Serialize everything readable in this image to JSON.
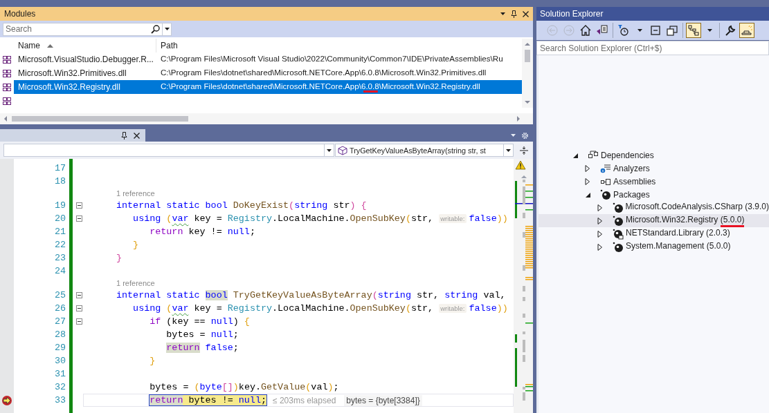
{
  "modules": {
    "title": "Modules",
    "search": {
      "placeholder": "Search"
    },
    "columns": [
      {
        "label": "Name",
        "sorted": true
      },
      {
        "label": "Path",
        "sorted": false
      }
    ],
    "rows": [
      {
        "name": "Microsoft.VisualStudio.Debugger.R...",
        "path": [
          {
            "text": "C:\\Program Files\\Microsoft Visual Studio\\2022\\Community\\Common7\\IDE\\PrivateAssemblies\\Ru",
            "annotated": false
          }
        ],
        "selected": false
      },
      {
        "name": "Microsoft.Win32.Primitives.dll",
        "path": [
          {
            "text": "C:\\Program Files\\dotnet\\shared\\Microsoft.NETCore.App\\6.0.8\\Microsoft.Win32.Primitives.dll",
            "annotated": false
          }
        ],
        "selected": false
      },
      {
        "name": "Microsoft.Win32.Registry.dll",
        "path": [
          {
            "text": "C:\\Program Files\\dotnet\\shared\\Microsoft.NETCore.App\\",
            "annotated": false
          },
          {
            "text": "6.0.8",
            "annotated": true
          },
          {
            "text": "\\Microsoft.Win32.Registry.dll",
            "annotated": false
          }
        ],
        "selected": true
      },
      {
        "selected": false
      }
    ]
  },
  "editor": {
    "navigation": {
      "member": "TryGetKeyValueAsByteArray(string str, st"
    },
    "lines": [
      {
        "kind": "code",
        "number": "17",
        "collapsible": false,
        "current": false
      },
      {
        "kind": "code",
        "number": "18",
        "collapsible": false,
        "current": false
      },
      {
        "kind": "codelens",
        "text": "1 reference"
      },
      {
        "kind": "code",
        "number": "19",
        "collapsible": true,
        "current": false,
        "tokens": [
          {
            "text": "internal static bool ",
            "kind": "kw"
          },
          {
            "text": "DoKeyExist",
            "kind": "method"
          },
          {
            "text": "(",
            "kind": "b1"
          },
          {
            "text": "string",
            "kind": "kw"
          },
          {
            "text": " str",
            "kind": "plain"
          },
          {
            "text": ")",
            "kind": "b1"
          },
          {
            "text": " {",
            "kind": "b1"
          }
        ]
      },
      {
        "kind": "code",
        "number": "20",
        "collapsible": true,
        "current": false,
        "tokens": [
          {
            "text": "   using ",
            "kind": "kw"
          },
          {
            "text": "(",
            "kind": "b2"
          },
          {
            "text": "var",
            "kind": "kw_squiggle"
          },
          {
            "text": " key = ",
            "kind": "plain"
          },
          {
            "text": "Registry",
            "kind": "type"
          },
          {
            "text": ".LocalMachine.",
            "kind": "plain"
          },
          {
            "text": "OpenSubKey",
            "kind": "method"
          },
          {
            "text": "(",
            "kind": "b2"
          },
          {
            "text": "str, ",
            "kind": "plain"
          },
          {
            "text": "writable:",
            "kind": "hint"
          },
          {
            "text": "false",
            "kind": "kw"
          },
          {
            "text": "))",
            "kind": "b2"
          }
        ]
      },
      {
        "kind": "code",
        "number": "21",
        "collapsible": false,
        "current": false,
        "tokens": [
          {
            "text": "      return",
            "kind": "ctl"
          },
          {
            "text": " key != ",
            "kind": "plain"
          },
          {
            "text": "null",
            "kind": "kw"
          },
          {
            "text": ";",
            "kind": "plain"
          }
        ]
      },
      {
        "kind": "code",
        "number": "22",
        "collapsible": false,
        "current": false,
        "tokens": [
          {
            "text": "   }",
            "kind": "b2"
          }
        ]
      },
      {
        "kind": "code",
        "number": "23",
        "collapsible": false,
        "current": false,
        "tokens": [
          {
            "text": "}",
            "kind": "b1"
          }
        ]
      },
      {
        "kind": "code",
        "number": "24",
        "collapsible": false,
        "current": false
      },
      {
        "kind": "codelens",
        "text": "1 reference"
      },
      {
        "kind": "code",
        "number": "25",
        "collapsible": true,
        "current": false,
        "tokens": [
          {
            "text": "internal static ",
            "kind": "kw"
          },
          {
            "text": "bool",
            "kind": "kw_ref"
          },
          {
            "text": " TryGetKeyValueAsByteArray",
            "kind": "method"
          },
          {
            "text": "(",
            "kind": "b1"
          },
          {
            "text": "string",
            "kind": "kw"
          },
          {
            "text": " str, ",
            "kind": "plain"
          },
          {
            "text": "string",
            "kind": "kw"
          },
          {
            "text": " val,",
            "kind": "plain"
          }
        ]
      },
      {
        "kind": "code",
        "number": "26",
        "collapsible": true,
        "current": false,
        "tokens": [
          {
            "text": "   using ",
            "kind": "kw"
          },
          {
            "text": "(",
            "kind": "b2"
          },
          {
            "text": "var",
            "kind": "kw_squiggle"
          },
          {
            "text": " key = ",
            "kind": "plain"
          },
          {
            "text": "Registry",
            "kind": "type"
          },
          {
            "text": ".LocalMachine.",
            "kind": "plain"
          },
          {
            "text": "OpenSubKey",
            "kind": "method"
          },
          {
            "text": "(",
            "kind": "b2"
          },
          {
            "text": "str, ",
            "kind": "plain"
          },
          {
            "text": "writable:",
            "kind": "hint"
          },
          {
            "text": "false",
            "kind": "kw"
          },
          {
            "text": "))",
            "kind": "b2"
          }
        ]
      },
      {
        "kind": "code",
        "number": "27",
        "collapsible": true,
        "current": false,
        "tokens": [
          {
            "text": "      if",
            "kind": "ctl"
          },
          {
            "text": " (key == ",
            "kind": "plain"
          },
          {
            "text": "null",
            "kind": "kw"
          },
          {
            "text": ") ",
            "kind": "plain"
          },
          {
            "text": "{",
            "kind": "b2"
          }
        ]
      },
      {
        "kind": "code",
        "number": "28",
        "collapsible": false,
        "current": false,
        "tokens": [
          {
            "text": "         bytes = ",
            "kind": "plain"
          },
          {
            "text": "null",
            "kind": "kw"
          },
          {
            "text": ";",
            "kind": "plain"
          }
        ]
      },
      {
        "kind": "code",
        "number": "29",
        "collapsible": false,
        "current": false,
        "tokens": [
          {
            "text": "         return",
            "kind": "ctl_ref"
          },
          {
            "text": " false",
            "kind": "kw"
          },
          {
            "text": ";",
            "kind": "plain"
          }
        ]
      },
      {
        "kind": "code",
        "number": "30",
        "collapsible": false,
        "current": false,
        "tokens": [
          {
            "text": "      }",
            "kind": "b2"
          }
        ]
      },
      {
        "kind": "code",
        "number": "31",
        "collapsible": false,
        "current": false
      },
      {
        "kind": "code",
        "number": "32",
        "collapsible": false,
        "current": false,
        "tokens": [
          {
            "text": "      bytes = ",
            "kind": "plain"
          },
          {
            "text": "(",
            "kind": "b2"
          },
          {
            "text": "byte",
            "kind": "kw"
          },
          {
            "text": "[]",
            "kind": "b1"
          },
          {
            "text": ")",
            "kind": "b2"
          },
          {
            "text": "key.",
            "kind": "plain"
          },
          {
            "text": "GetValue",
            "kind": "method"
          },
          {
            "text": "(",
            "kind": "b2"
          },
          {
            "text": "val",
            "kind": "plain"
          },
          {
            "text": ")",
            "kind": "b2"
          },
          {
            "text": ";",
            "kind": "plain"
          }
        ]
      },
      {
        "kind": "code",
        "number": "33",
        "collapsible": false,
        "current": true,
        "tokens": [
          {
            "text": "      return",
            "kind": "ctl_ref"
          },
          {
            "text": " bytes != ",
            "kind": "plain"
          },
          {
            "text": "null",
            "kind": "kw"
          },
          {
            "text": ";",
            "kind": "plain"
          }
        ],
        "after": [
          {
            "text": "≤ 203ms elapsed",
            "kind": "perf_tip"
          },
          {
            "text": "bytes = {byte[3384]}",
            "kind": "datatip"
          }
        ]
      }
    ]
  },
  "solution_explorer": {
    "title": "Solution Explorer",
    "toolbar": [
      [
        {
          "kind": "back",
          "disabled": true,
          "on": false
        },
        {
          "kind": "forward",
          "disabled": true,
          "on": false
        },
        {
          "kind": "home",
          "disabled": false,
          "on": false
        },
        {
          "kind": "switch_views",
          "disabled": false,
          "on": false
        }
      ],
      [
        {
          "kind": "pending_changes",
          "disabled": false,
          "on": false
        },
        {
          "kind": "dropdown",
          "disabled": false,
          "on": false
        },
        {
          "kind": "collapse_all",
          "disabled": false,
          "on": false
        },
        {
          "kind": "show_all",
          "disabled": false,
          "on": false
        }
      ],
      [
        {
          "kind": "sync",
          "disabled": false,
          "on": true
        },
        {
          "kind": "dropdown",
          "disabled": false,
          "on": false
        }
      ],
      [
        {
          "kind": "properties",
          "disabled": false,
          "on": false
        },
        {
          "kind": "preview",
          "disabled": false,
          "on": true
        }
      ]
    ],
    "search": {
      "placeholder": "Search Solution Explorer (Ctrl+$)"
    },
    "tree": [
      {
        "label": "Dependencies",
        "kind": "dependencies",
        "expanded": true,
        "selected": false,
        "children": [
          {
            "label": "Analyzers",
            "kind": "analyzers",
            "expanded": false,
            "selected": false
          },
          {
            "label": "Assemblies",
            "kind": "assemblies",
            "expanded": false,
            "selected": false
          },
          {
            "label": "Packages",
            "kind": "packages",
            "expanded": true,
            "selected": false,
            "children": [
              {
                "label": "Microsoft.CodeAnalysis.CSharp",
                "version": "(3.9.0)",
                "kind": "package",
                "expanded": false,
                "selected": false,
                "annotated": false
              },
              {
                "label": "Microsoft.Win32.Registry",
                "version": "(5.0.0)",
                "kind": "package",
                "expanded": false,
                "selected": true,
                "annotated": true
              },
              {
                "label": "NETStandard.Library",
                "version": "(2.0.3)",
                "kind": "package_locked",
                "expanded": false,
                "selected": false,
                "annotated": false
              },
              {
                "label": "System.Management",
                "version": "(5.0.0)",
                "kind": "package",
                "expanded": false,
                "selected": false,
                "annotated": false
              }
            ]
          }
        ]
      }
    ]
  }
}
